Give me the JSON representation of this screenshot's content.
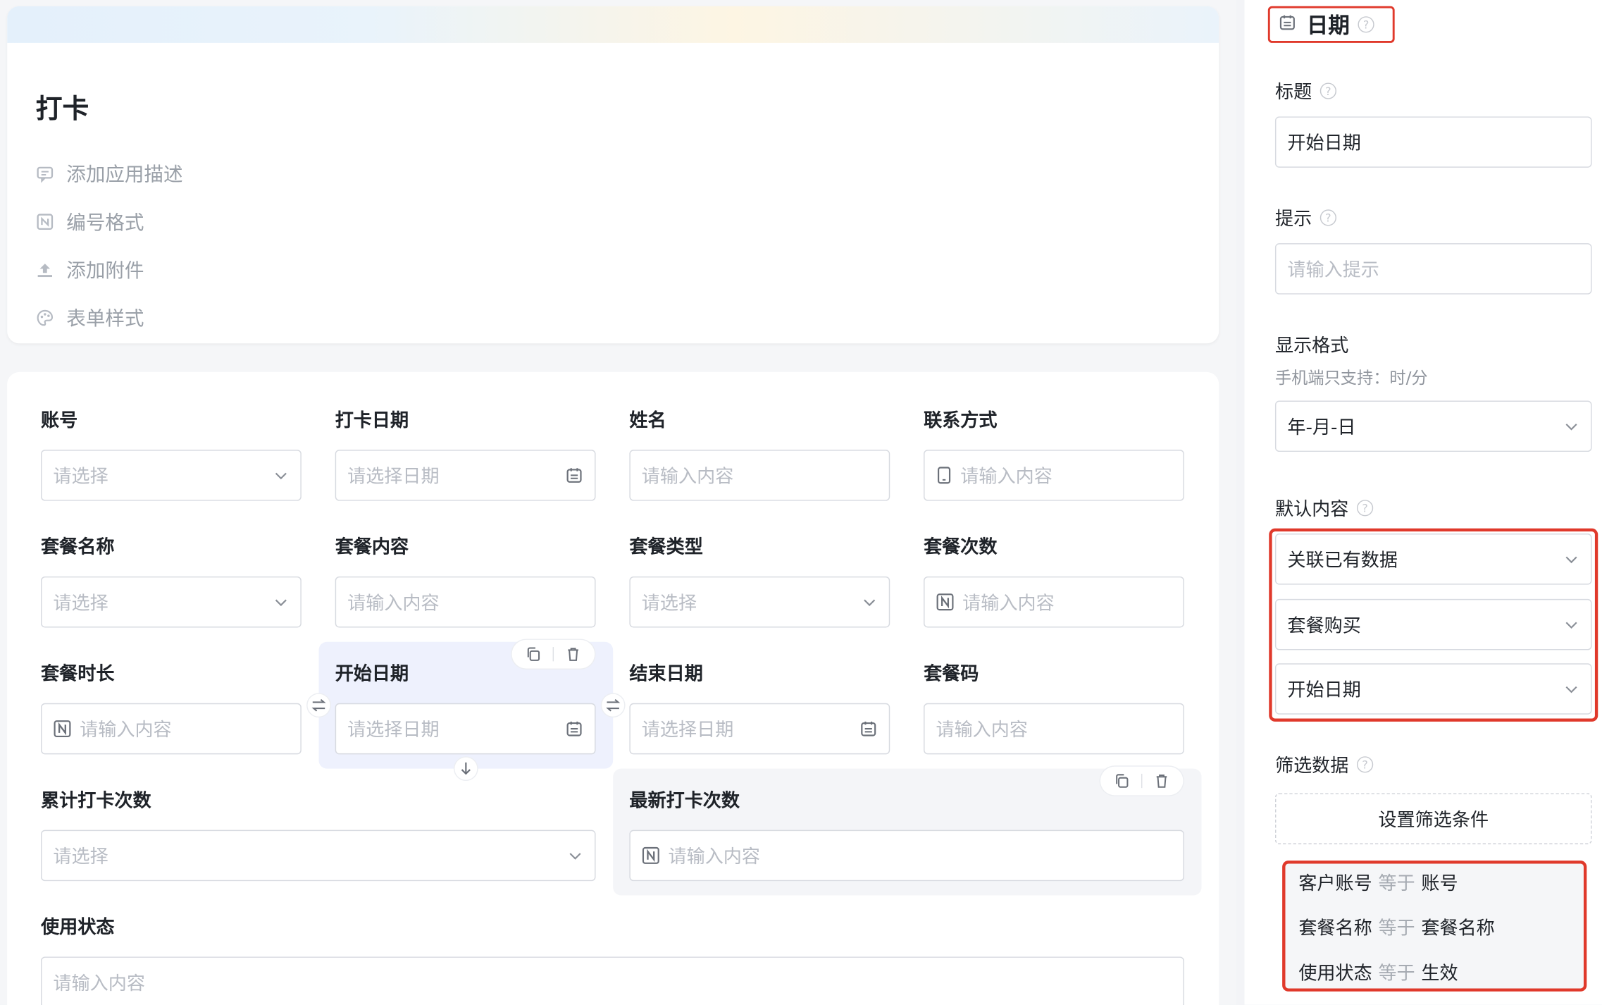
{
  "app": {
    "title": "打卡",
    "meta": [
      {
        "icon": "comment-icon",
        "label": "添加应用描述"
      },
      {
        "icon": "number-format-icon",
        "label": "编号格式"
      },
      {
        "icon": "upload-icon",
        "label": "添加附件"
      },
      {
        "icon": "palette-icon",
        "label": "表单样式"
      }
    ]
  },
  "form": {
    "fields": [
      {
        "label": "账号",
        "placeholder": "请选择",
        "kind": "select"
      },
      {
        "label": "打卡日期",
        "placeholder": "请选择日期",
        "kind": "date"
      },
      {
        "label": "姓名",
        "placeholder": "请输入内容",
        "kind": "text"
      },
      {
        "label": "联系方式",
        "placeholder": "请输入内容",
        "kind": "phone"
      },
      {
        "label": "套餐名称",
        "placeholder": "请选择",
        "kind": "select"
      },
      {
        "label": "套餐内容",
        "placeholder": "请输入内容",
        "kind": "text"
      },
      {
        "label": "套餐类型",
        "placeholder": "请选择",
        "kind": "select"
      },
      {
        "label": "套餐次数",
        "placeholder": "请输入内容",
        "kind": "number"
      },
      {
        "label": "套餐时长",
        "placeholder": "请输入内容",
        "kind": "number"
      },
      {
        "label": "开始日期",
        "placeholder": "请选择日期",
        "kind": "date"
      },
      {
        "label": "结束日期",
        "placeholder": "请选择日期",
        "kind": "date"
      },
      {
        "label": "套餐码",
        "placeholder": "请输入内容",
        "kind": "text"
      },
      {
        "label": "累计打卡次数",
        "placeholder": "请选择",
        "kind": "select"
      },
      {
        "label": "最新打卡次数",
        "placeholder": "请输入内容",
        "kind": "number"
      },
      {
        "label": "使用状态",
        "placeholder": "请输入内容",
        "kind": "text"
      }
    ]
  },
  "panel": {
    "type_title": "日期",
    "title_label": "标题",
    "title_value": "开始日期",
    "hint_label": "提示",
    "hint_placeholder": "请输入提示",
    "format_label": "显示格式",
    "format_sub": "手机端只支持：时/分",
    "format_value": "年-月-日",
    "default_label": "默认内容",
    "default_mode": "关联已有数据",
    "default_source": "套餐购买",
    "default_field": "开始日期",
    "filter_label": "筛选数据",
    "filter_button": "设置筛选条件",
    "conditions": [
      {
        "field": "客户账号",
        "op": "等于",
        "value": "账号"
      },
      {
        "field": "套餐名称",
        "op": "等于",
        "value": "套餐名称"
      },
      {
        "field": "使用状态",
        "op": "等于",
        "value": "生效"
      }
    ]
  },
  "colors": {
    "accent_red": "#e0392b",
    "selected_bg": "#eef1fd"
  }
}
